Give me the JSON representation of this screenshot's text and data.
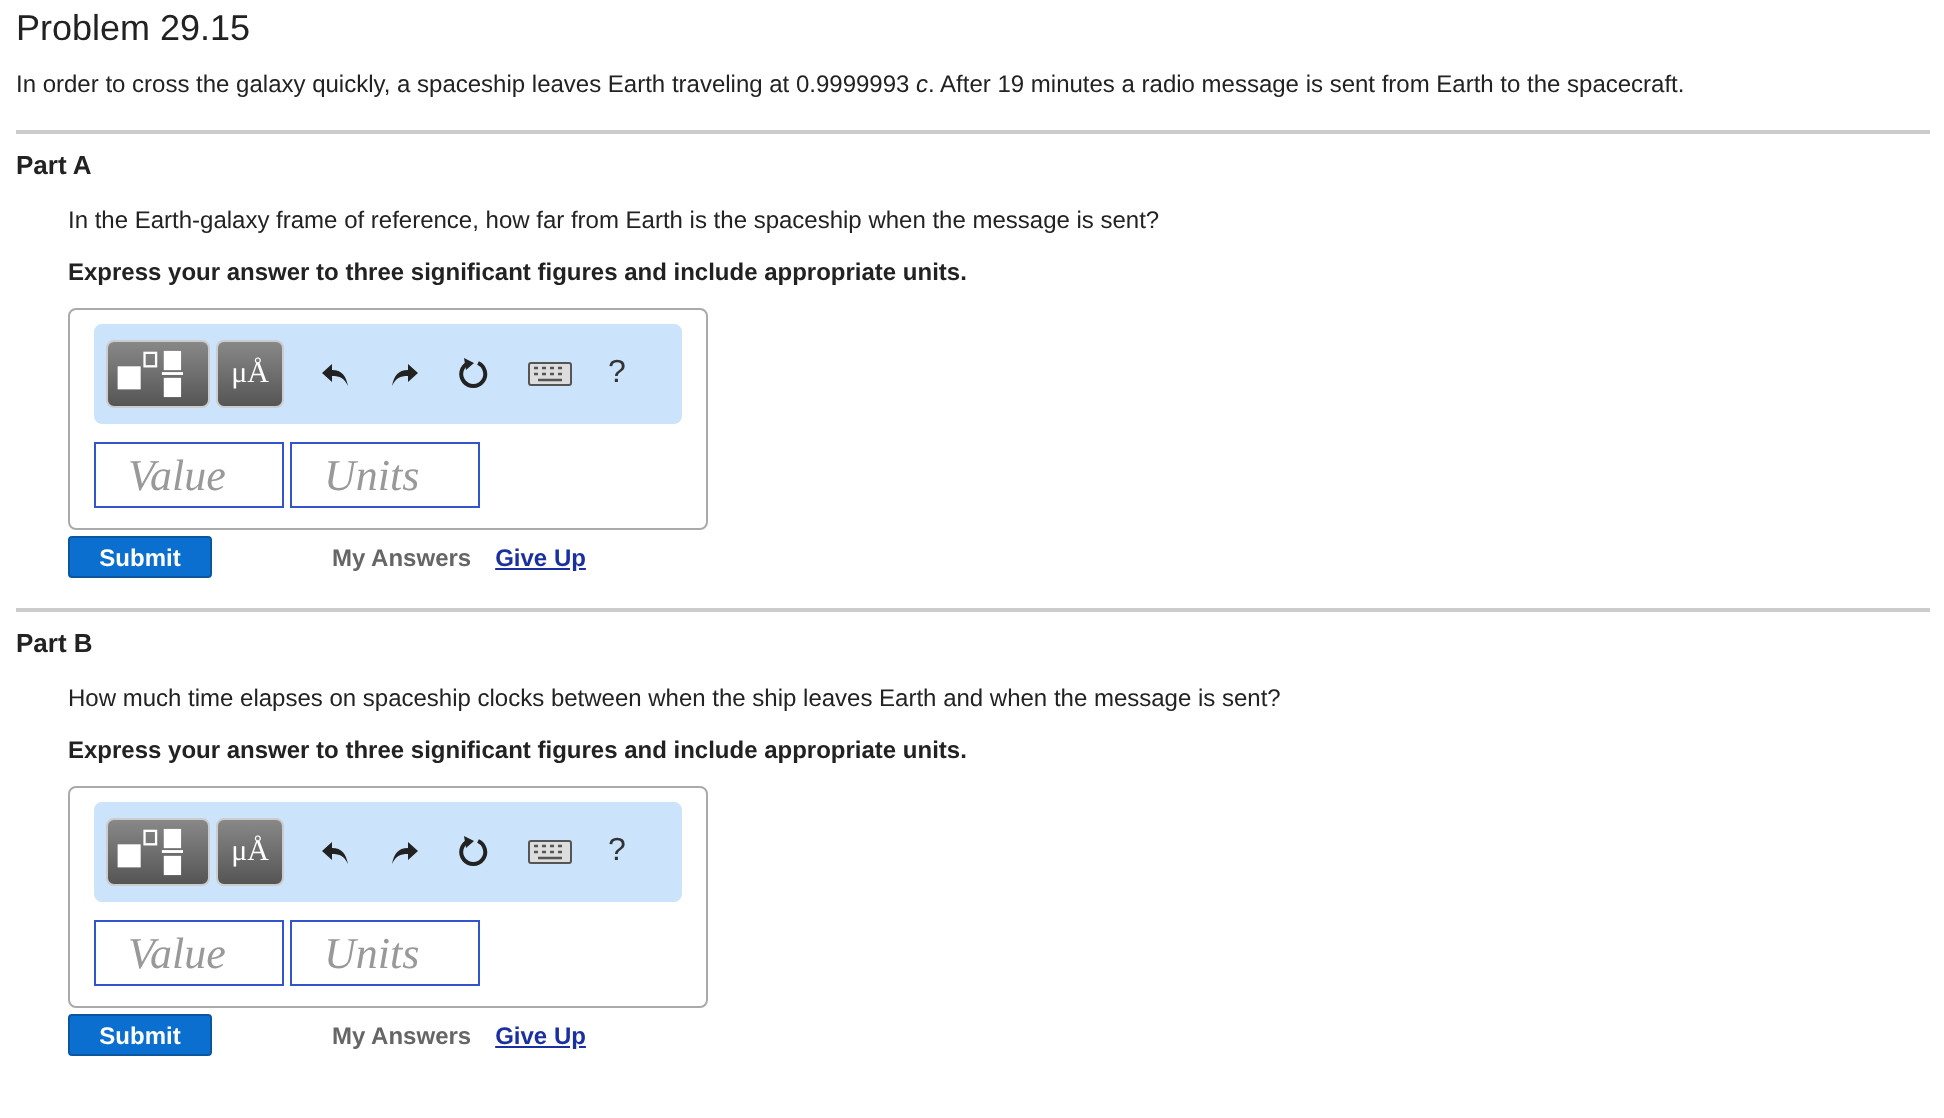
{
  "title": "Problem 29.15",
  "intro": "In order to cross the galaxy quickly, a spaceship leaves Earth traveling at 0.9999993 *c*. After 19 minutes a radio message is sent from Earth to the spacecraft.",
  "parts": [
    {
      "label": "Part A",
      "question": "In the Earth-galaxy frame of reference, how far from Earth is the spaceship when the message is sent?",
      "instruction": "Express your answer to three significant figures and include appropriate units.",
      "units_button": "μÅ",
      "help": "?",
      "value_placeholder": "Value",
      "units_placeholder": "Units",
      "submit": "Submit",
      "my_answers": "My Answers",
      "give_up": "Give Up"
    },
    {
      "label": "Part B",
      "question": "How much time elapses on spaceship clocks between when the ship leaves Earth and when the message is sent?",
      "instruction": "Express your answer to three significant figures and include appropriate units.",
      "units_button": "μÅ",
      "help": "?",
      "value_placeholder": "Value",
      "units_placeholder": "Units",
      "submit": "Submit",
      "my_answers": "My Answers",
      "give_up": "Give Up"
    }
  ]
}
